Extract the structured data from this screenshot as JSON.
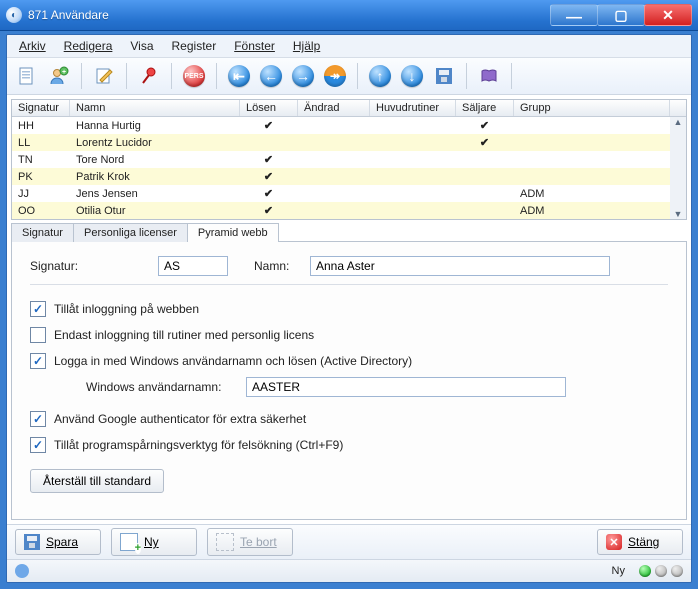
{
  "window": {
    "title": "871 Användare"
  },
  "menu": {
    "arkiv": "Arkiv",
    "redigera": "Redigera",
    "visa": "Visa",
    "register": "Register",
    "fonster": "Fönster",
    "hjalp": "Hjälp"
  },
  "toolbar_icons": {
    "new_doc": "new-document-icon",
    "add_user": "add-user-icon",
    "edit": "edit-note-icon",
    "pin": "pin-icon",
    "pers": "pers-badge-icon",
    "first": "nav-first-icon",
    "prev": "nav-prev-icon",
    "next": "nav-next-icon",
    "last": "nav-last-icon",
    "up": "nav-up-icon",
    "down": "nav-down-icon",
    "save": "save-icon",
    "book": "book-help-icon"
  },
  "grid": {
    "headers": {
      "signatur": "Signatur",
      "namn": "Namn",
      "losen": "Lösen",
      "andrad": "Ändrad",
      "huvud": "Huvudrutiner",
      "saljare": "Säljare",
      "grupp": "Grupp"
    },
    "rows": [
      {
        "sig": "HH",
        "name": "Hanna Hurtig",
        "losen": "✔",
        "andrad": "",
        "huvud": "",
        "salj": "✔",
        "grupp": "",
        "alt": false
      },
      {
        "sig": "LL",
        "name": "Lorentz Lucidor",
        "losen": "",
        "andrad": "",
        "huvud": "",
        "salj": "✔",
        "grupp": "",
        "alt": true
      },
      {
        "sig": "TN",
        "name": "Tore Nord",
        "losen": "✔",
        "andrad": "",
        "huvud": "",
        "salj": "",
        "grupp": "",
        "alt": false
      },
      {
        "sig": "PK",
        "name": "Patrik Krok",
        "losen": "✔",
        "andrad": "",
        "huvud": "",
        "salj": "",
        "grupp": "",
        "alt": true
      },
      {
        "sig": "JJ",
        "name": "Jens Jensen",
        "losen": "✔",
        "andrad": "",
        "huvud": "",
        "salj": "",
        "grupp": "ADM",
        "alt": false
      },
      {
        "sig": "OO",
        "name": "Otilia Otur",
        "losen": "✔",
        "andrad": "",
        "huvud": "",
        "salj": "",
        "grupp": "ADM",
        "alt": true
      }
    ]
  },
  "tabs": {
    "signatur": "Signatur",
    "personliga": "Personliga licenser",
    "pyramid": "Pyramid webb"
  },
  "form": {
    "signatur_label": "Signatur:",
    "signatur_value": "AS",
    "namn_label": "Namn:",
    "namn_value": "Anna Aster",
    "chk_webb": "Tillåt inloggning på webben",
    "chk_licens": "Endast inloggning till rutiner med personlig licens",
    "chk_ad": "Logga in med Windows användarnamn och lösen (Active Directory)",
    "winuser_label": "Windows användarnamn:",
    "winuser_value": "AASTER",
    "chk_google": "Använd Google authenticator för extra säkerhet",
    "chk_debug": "Tillåt programspårningsverktyg för felsökning (Ctrl+F9)",
    "reset_btn": "Återställ till standard"
  },
  "bottom": {
    "save": "Spara",
    "ny": "Ny",
    "tebort": "Te bort",
    "stang": "Stäng"
  },
  "status": {
    "ny": "Ny"
  }
}
